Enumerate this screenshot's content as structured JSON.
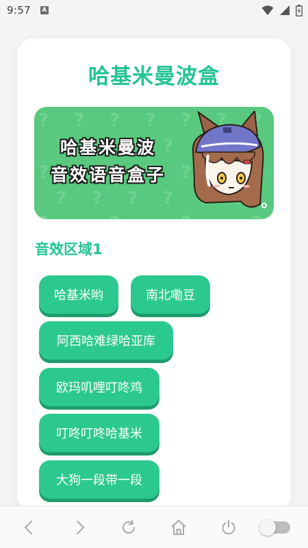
{
  "status_bar": {
    "time": "9:57",
    "notification_icon": "A",
    "icons": [
      "wifi-icon",
      "signal-icon",
      "battery-charging-icon"
    ]
  },
  "app": {
    "title": "哈基米曼波盒",
    "banner": {
      "line1": "哈基米曼波",
      "line2": "音效语音盒子"
    },
    "section_title": "音效区域1",
    "buttons": [
      {
        "label": "哈基米哟"
      },
      {
        "label": "南北嘞豆"
      },
      {
        "label": "阿西哈难绿哈亚库"
      },
      {
        "label": "欧玛叽哩叮咚鸡"
      },
      {
        "label": "叮咚叮咚哈基米"
      },
      {
        "label": "大狗一段带一段"
      }
    ]
  },
  "bottom_nav": {
    "items": [
      "back-icon",
      "forward-icon",
      "refresh-icon",
      "home-icon",
      "power-icon",
      "toggle-switch"
    ],
    "toggle_on": false
  },
  "colors": {
    "accent": "#22c493",
    "button": "#2cc98f",
    "button_shadow": "#1d9c6d",
    "banner": "#58c97e"
  }
}
